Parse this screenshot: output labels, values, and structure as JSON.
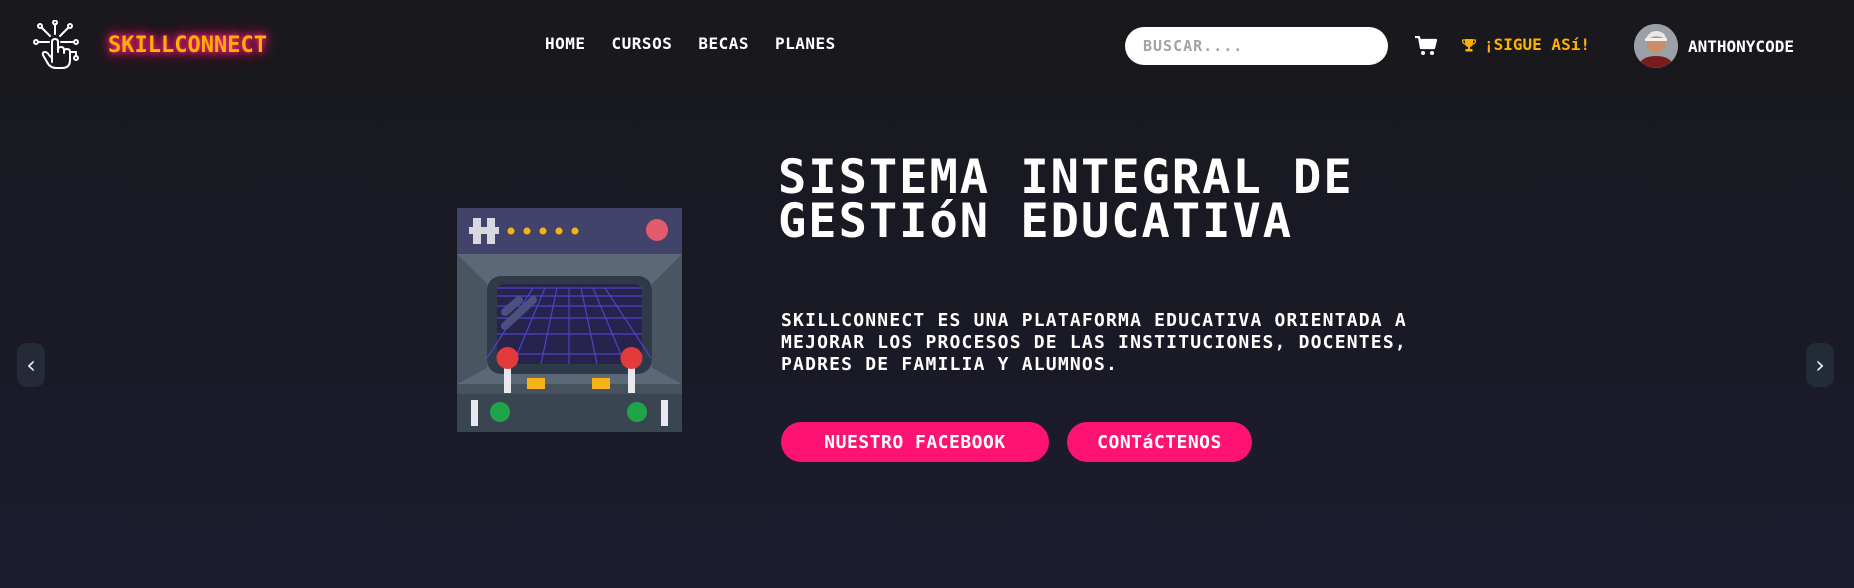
{
  "brand": {
    "name": "SKILLCONNECT",
    "icon": "hand-circuit-icon"
  },
  "nav": {
    "items": [
      "HOME",
      "CURSOS",
      "BECAS",
      "PLANES"
    ]
  },
  "search": {
    "placeholder": "BUSCAR...."
  },
  "cart": {
    "icon": "cart-icon"
  },
  "motivation": {
    "icon": "trophy-icon",
    "text": "¡SIGUE ASí!"
  },
  "user": {
    "name": "ANTHONYCODE",
    "icon": "avatar"
  },
  "hero": {
    "title": "SISTEMA INTEGRAL DE GESTIóN EDUCATIVA",
    "description": "SKILLCONNECT ES UNA PLATAFORMA EDUCATIVA ORIENTADA A MEJORAR LOS PROCESOS DE LAS INSTITUCIONES, DOCENTES, PADRES DE FAMILIA Y ALUMNOS.",
    "buttons": {
      "facebook": "NUESTRO FACEBOOK",
      "contact": "CONTáCTENOS"
    },
    "illustration": "arcade-machine-icon"
  },
  "carousel": {
    "prev": "‹",
    "next": "›"
  },
  "colors": {
    "accent": "#ff1372",
    "brand": "#ffb000",
    "background": "#19191d"
  }
}
